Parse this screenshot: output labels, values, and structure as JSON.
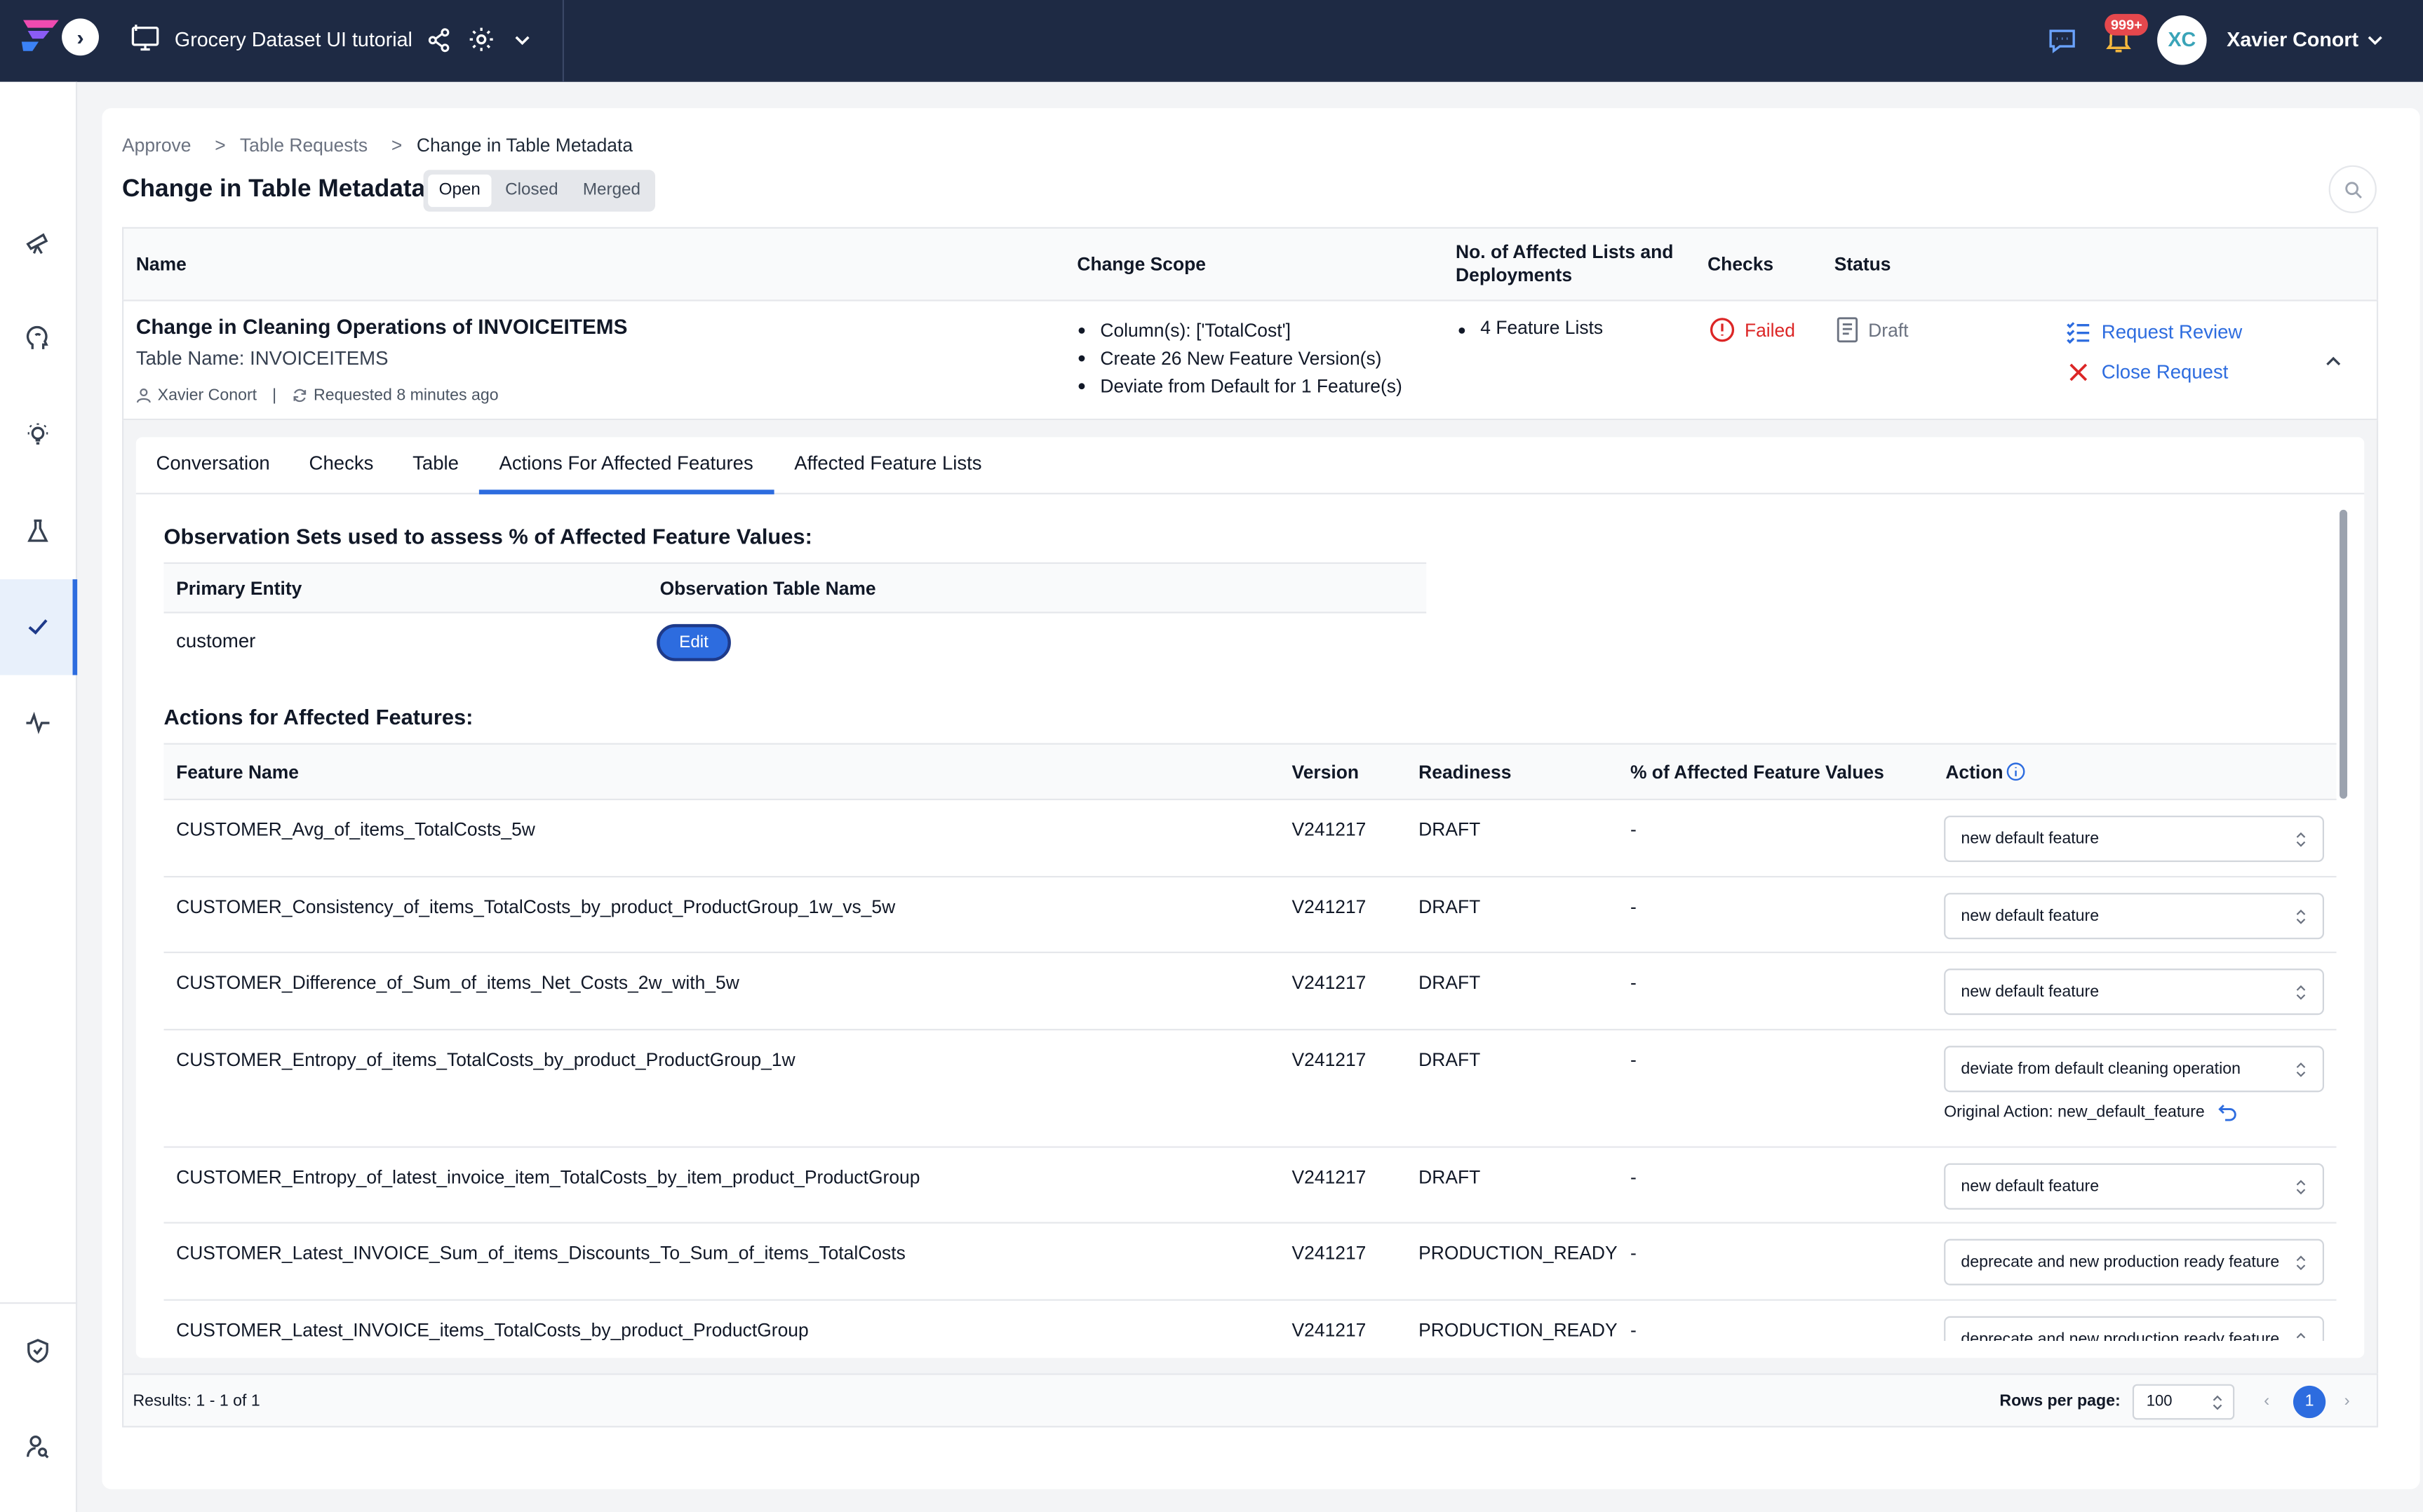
{
  "header": {
    "project_title": "Grocery Dataset UI tutorial",
    "notifications_badge": "999+",
    "avatar_initials": "XC",
    "user_name": "Xavier Conort"
  },
  "breadcrumb": {
    "items": [
      "Approve",
      "Table Requests",
      "Change in Table Metadata"
    ],
    "separator": ">"
  },
  "page": {
    "title": "Change in Table Metadata",
    "filters": [
      "Open",
      "Closed",
      "Merged"
    ],
    "active_filter": "Open"
  },
  "request_table": {
    "columns": {
      "name": "Name",
      "change_scope": "Change Scope",
      "affected_lists": "No. of Affected Lists and Deployments",
      "checks": "Checks",
      "status": "Status"
    },
    "row": {
      "title": "Change in Cleaning Operations of INVOICEITEMS",
      "table_name": "Table Name: INVOICEITEMS",
      "author": "Xavier Conort",
      "requested": "Requested 8 minutes ago",
      "meta_separator": "|",
      "scope": [
        "Column(s): ['TotalCost']",
        "Create 26 New Feature Version(s)",
        "Deviate from Default for 1 Feature(s)"
      ],
      "affected": "4 Feature Lists",
      "checks": "Failed",
      "status": "Draft",
      "request_review": "Request Review",
      "close_request": "Close Request"
    }
  },
  "tabs": [
    "Conversation",
    "Checks",
    "Table",
    "Actions For Affected Features",
    "Affected Feature Lists"
  ],
  "active_tab": "Actions For Affected Features",
  "observation": {
    "title": "Observation Sets used to assess % of Affected Feature Values:",
    "columns": [
      "Primary Entity",
      "Observation Table Name"
    ],
    "entity": "customer",
    "edit_label": "Edit"
  },
  "features": {
    "title": "Actions for Affected Features:",
    "columns": [
      "Feature Name",
      "Version",
      "Readiness",
      "% of Affected Feature Values",
      "Action"
    ],
    "rows": [
      {
        "name": "CUSTOMER_Avg_of_items_TotalCosts_5w",
        "version": "V241217",
        "readiness": "DRAFT",
        "pct": "-",
        "action": "new default feature"
      },
      {
        "name": "CUSTOMER_Consistency_of_items_TotalCosts_by_product_ProductGroup_1w_vs_5w",
        "version": "V241217",
        "readiness": "DRAFT",
        "pct": "-",
        "action": "new default feature"
      },
      {
        "name": "CUSTOMER_Difference_of_Sum_of_items_Net_Costs_2w_with_5w",
        "version": "V241217",
        "readiness": "DRAFT",
        "pct": "-",
        "action": "new default feature"
      },
      {
        "name": "CUSTOMER_Entropy_of_items_TotalCosts_by_product_ProductGroup_1w",
        "version": "V241217",
        "readiness": "DRAFT",
        "pct": "-",
        "action": "deviate from default cleaning operation",
        "original": "Original Action: new_default_feature"
      },
      {
        "name": "CUSTOMER_Entropy_of_latest_invoice_item_TotalCosts_by_item_product_ProductGroup",
        "version": "V241217",
        "readiness": "DRAFT",
        "pct": "-",
        "action": "new default feature"
      },
      {
        "name": "CUSTOMER_Latest_INVOICE_Sum_of_items_Discounts_To_Sum_of_items_TotalCosts",
        "version": "V241217",
        "readiness": "PRODUCTION_READY",
        "pct": "-",
        "action": "deprecate and new production ready feature"
      },
      {
        "name": "CUSTOMER_Latest_INVOICE_items_TotalCosts_by_product_ProductGroup",
        "version": "V241217",
        "readiness": "PRODUCTION_READY",
        "pct": "-",
        "action": "deprecate and new production ready feature"
      }
    ]
  },
  "footer": {
    "results": "Results: 1 - 1 of 1",
    "rows_per_page_label": "Rows per page:",
    "rows_per_page": "100",
    "current_page": "1",
    "prev": "‹",
    "next": "›"
  },
  "colors": {
    "topbar": "#1e2a44",
    "accent": "#2d6cdf",
    "failed": "#dc2626",
    "badge": "#e5484d"
  }
}
